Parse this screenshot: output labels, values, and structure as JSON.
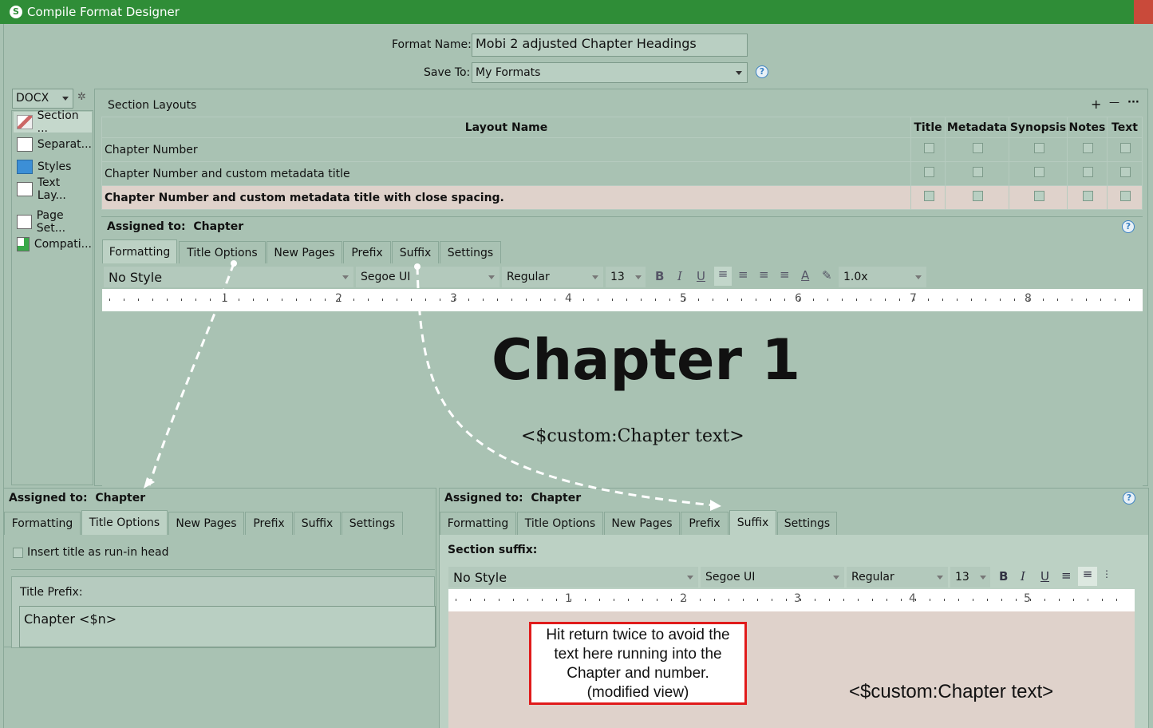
{
  "window": {
    "title": "Compile Format Designer",
    "app_icon": "S"
  },
  "header": {
    "format_name_label": "Format Name:",
    "format_name_value": "Mobi 2 adjusted Chapter Headings",
    "save_to_label": "Save To:",
    "save_to_value": "My Formats",
    "help": "?"
  },
  "sidebar": {
    "format_select": "DOCX",
    "items": [
      {
        "label": "Section ...",
        "icon": "brush-icon"
      },
      {
        "label": "Separat...",
        "icon": "separator-icon"
      },
      {
        "label": "Styles",
        "icon": "styles-icon"
      },
      {
        "label": "Text Lay...",
        "icon": "text-layout-icon"
      },
      {
        "label": "Page Set...",
        "icon": "page-setup-icon"
      },
      {
        "label": "Compati...",
        "icon": "compatibility-icon"
      }
    ]
  },
  "section_layouts": {
    "title": "Section Layouts",
    "add": "+",
    "remove": "—",
    "more": "···",
    "columns": [
      "Layout Name",
      "Title",
      "Metadata",
      "Synopsis",
      "Notes",
      "Text"
    ],
    "rows": [
      {
        "name": "Chapter Number"
      },
      {
        "name": "Chapter Number and custom metadata title"
      },
      {
        "name": "Chapter Number and custom metadata title with close spacing."
      }
    ]
  },
  "top_assigned": {
    "label": "Assigned to:",
    "value": "Chapter",
    "tabs": [
      "Formatting",
      "Title Options",
      "New Pages",
      "Prefix",
      "Suffix",
      "Settings"
    ],
    "style": "No Style",
    "font": "Segoe UI",
    "weight": "Regular",
    "size": "13",
    "spacing": "1.0x",
    "ruler_numbers": [
      "1",
      "2",
      "3",
      "4",
      "5",
      "6",
      "7",
      "8"
    ],
    "preview_heading": "Chapter 1",
    "preview_text": "<$custom:Chapter text>"
  },
  "bottom_left": {
    "label": "Assigned to:",
    "value": "Chapter",
    "tabs": [
      "Formatting",
      "Title Options",
      "New Pages",
      "Prefix",
      "Suffix",
      "Settings"
    ],
    "run_in_label": "Insert title as run-in head",
    "title_prefix_label": "Title Prefix:",
    "title_prefix_value": "Chapter <$n>"
  },
  "bottom_right": {
    "label": "Assigned to:",
    "value": "Chapter",
    "tabs": [
      "Formatting",
      "Title Options",
      "New Pages",
      "Prefix",
      "Suffix",
      "Settings"
    ],
    "section_suffix_label": "Section suffix:",
    "style": "No Style",
    "font": "Segoe UI",
    "weight": "Regular",
    "size": "13",
    "ruler_numbers": [
      "1",
      "2",
      "3",
      "4",
      "5"
    ],
    "note_lines": [
      "Hit return twice to avoid the",
      "text here running into the",
      "Chapter and number.",
      "(modified view)"
    ],
    "suffix_text": "<$custom:Chapter text>"
  },
  "colors": {
    "titlebar": "#2f8d37",
    "panel": "#a9c2b3",
    "selected_row": "#dfd2cb",
    "note_border": "#e01b1b"
  }
}
